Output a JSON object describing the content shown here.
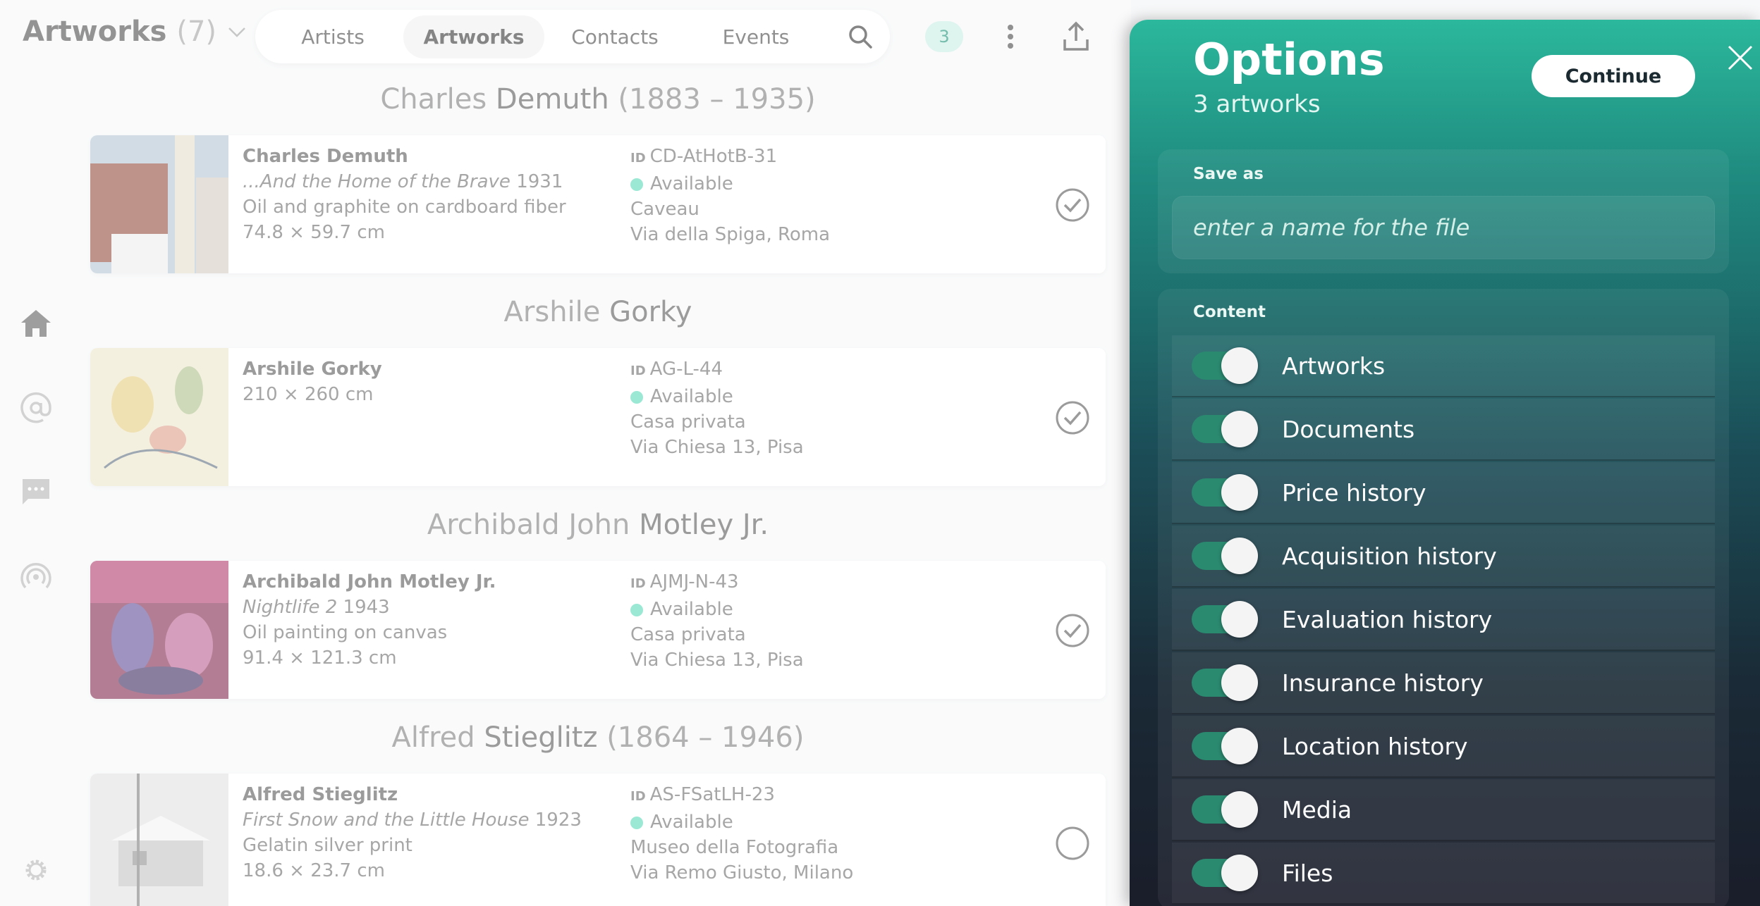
{
  "header": {
    "title": "Artworks",
    "count": "(7)",
    "tabs": [
      {
        "label": "Artists"
      },
      {
        "label": "Artworks"
      },
      {
        "label": "Contacts"
      },
      {
        "label": "Events"
      }
    ],
    "badge": "3"
  },
  "groups": [
    {
      "first": "Charles",
      "last": "Demuth",
      "years": "(1883 – 1935)",
      "name": "Charles Demuth",
      "title": "...And the Home of the Brave",
      "year": "1931",
      "medium": "Oil and graphite on cardboard fiber",
      "size": "74.8 × 59.7 cm",
      "id_label": "ID",
      "id": "CD-AtHotB-31",
      "status": "Available",
      "location": "Caveau",
      "address": "Via della Spiga, Roma",
      "checked": true
    },
    {
      "first": "Arshile",
      "last": "Gorky",
      "years": "",
      "name": "Arshile Gorky",
      "title": "",
      "year": "",
      "medium": "210 × 260 cm",
      "size": "",
      "id_label": "ID",
      "id": "AG-L-44",
      "status": "Available",
      "location": "Casa privata",
      "address": "Via Chiesa 13, Pisa",
      "checked": true
    },
    {
      "first": "Archibald John",
      "last": "Motley Jr.",
      "years": "",
      "name": "Archibald John Motley Jr.",
      "title": "Nightlife 2",
      "year": "1943",
      "medium": "Oil painting on canvas",
      "size": "91.4 × 121.3 cm",
      "id_label": "ID",
      "id": "AJMJ-N-43",
      "status": "Available",
      "location": "Casa privata",
      "address": "Via Chiesa 13, Pisa",
      "checked": true
    },
    {
      "first": "Alfred",
      "last": "Stieglitz",
      "years": "(1864 – 1946)",
      "name": "Alfred Stieglitz",
      "title": "First Snow and the Little House",
      "year": "1923",
      "medium": "Gelatin silver print",
      "size": "18.6 × 23.7 cm",
      "id_label": "ID",
      "id": "AS-FSatLH-23",
      "status": "Available",
      "location": "Museo della Fotografia",
      "address": "Via Remo Giusto, Milano",
      "checked": false
    }
  ],
  "panel": {
    "title": "Options",
    "subtitle": "3 artworks",
    "continue_label": "Continue",
    "save_as_label": "Save as",
    "save_as_placeholder": "enter a name for the file",
    "content_label": "Content",
    "options": [
      {
        "label": "Artworks",
        "on": true
      },
      {
        "label": "Documents",
        "on": true
      },
      {
        "label": "Price history",
        "on": true
      },
      {
        "label": "Acquisition history",
        "on": true
      },
      {
        "label": "Evaluation history",
        "on": true
      },
      {
        "label": "Insurance history",
        "on": true
      },
      {
        "label": "Location history",
        "on": true
      },
      {
        "label": "Media",
        "on": true
      },
      {
        "label": "Files",
        "on": true
      }
    ]
  },
  "colors": {
    "accent": "#2bb89c",
    "available": "#66dcbd",
    "toggle_on": "#2a8a70"
  }
}
